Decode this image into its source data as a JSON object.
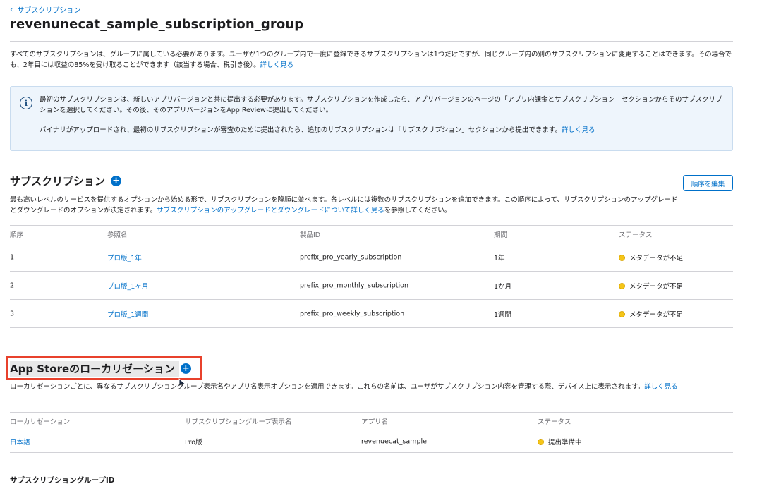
{
  "breadcrumb": {
    "parent": "サブスクリプション"
  },
  "page": {
    "title": "revenunecat_sample_subscription_group"
  },
  "intro": {
    "text": "すべてのサブスクリプションは、グループに属している必要があります。ユーザが1つのグループ内で一度に登録できるサブスクリプションは1つだけですが、同じグループ内の別のサブスクリプションに変更することはできます。その場合でも、2年目には収益の85%を受け取ることができます（該当する場合、税引き後）。",
    "link": "詳しく見る"
  },
  "info": {
    "para1": "最初のサブスクリプションは、新しいアプリバージョンと共に提出する必要があります。サブスクリプションを作成したら、アプリバージョンのページの「アプリ内課金とサブスクリプション」セクションからそのサブスクリプションを選択してください。その後、そのアプリバージョンをApp Reviewに提出してください。",
    "para2": "バイナリがアップロードされ、最初のサブスクリプションが審査のために提出されたら、追加のサブスクリプションは「サブスクリプション」セクションから提出できます。",
    "link": "詳しく見る"
  },
  "subscriptions": {
    "title": "サブスクリプション",
    "edit_order_label": "順序を編集",
    "desc_prefix": "最も高いレベルのサービスを提供するオプションから始める形で、サブスクリプションを降順に並べます。各レベルには複数のサブスクリプションを追加できます。この順序によって、サブスクリプションのアップグレードとダウングレードのオプションが決定されます。",
    "desc_link": "サブスクリプションのアップグレードとダウングレードについて詳しく見る",
    "desc_suffix": "を参照してください。",
    "columns": [
      "順序",
      "参照名",
      "製品ID",
      "期間",
      "ステータス"
    ],
    "rows": [
      {
        "order": "1",
        "name": "プロ版_1年",
        "product_id": "prefix_pro_yearly_subscription",
        "period": "1年",
        "status": "メタデータが不足"
      },
      {
        "order": "2",
        "name": "プロ版_1ヶ月",
        "product_id": "prefix_pro_monthly_subscription",
        "period": "1か月",
        "status": "メタデータが不足"
      },
      {
        "order": "3",
        "name": "プロ版_1週間",
        "product_id": "prefix_pro_weekly_subscription",
        "period": "1週間",
        "status": "メタデータが不足"
      }
    ]
  },
  "localization": {
    "title": "App Storeのローカリゼーション",
    "desc": "ローカリゼーションごとに、異なるサブスクリプショングループ表示名やアプリ名表示オプションを適用できます。これらの名前は、ユーザがサブスクリプション内容を管理する際、デバイス上に表示されます。",
    "link": "詳しく見る",
    "columns": [
      "ローカリゼーション",
      "サブスクリプショングループ表示名",
      "アプリ名",
      "ステータス"
    ],
    "rows": [
      {
        "locale": "日本語",
        "display_name": "Pro版",
        "app_name": "revenuecat_sample",
        "status": "提出準備中"
      }
    ]
  },
  "group_id": {
    "label": "サブスクリプショングループID"
  },
  "colors": {
    "accent": "#0070c9",
    "warning": "#f5c518",
    "highlight": "#e8412c",
    "info_bg": "#eef5fc"
  }
}
